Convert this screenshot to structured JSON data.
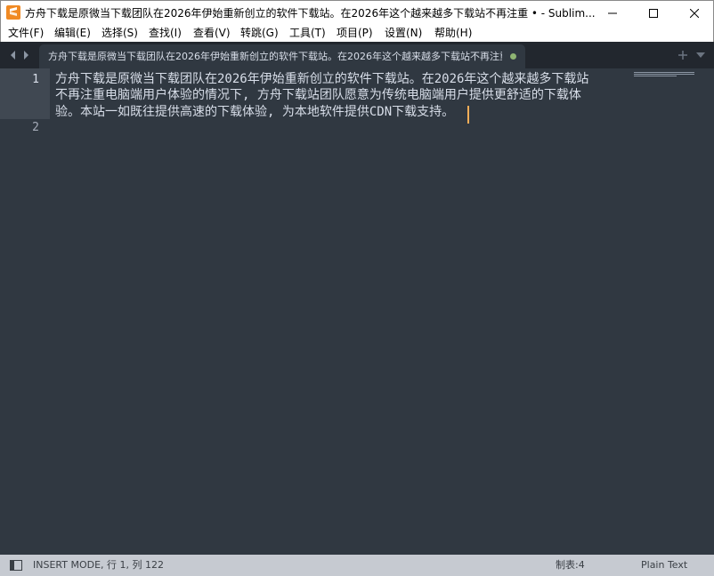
{
  "window": {
    "title": "方舟下载是原微当下载团队在2026年伊始重新创立的软件下载站。在2026年这个越来越多下载站不再注重 • - Sublim...",
    "app_icon": "sublime-text-icon",
    "buttons": {
      "minimize_icon": "minimize-icon",
      "maximize_icon": "maximize-icon",
      "close_icon": "close-icon"
    }
  },
  "menu": {
    "items": [
      "文件(F)",
      "编辑(E)",
      "选择(S)",
      "查找(I)",
      "查看(V)",
      "转跳(G)",
      "工具(T)",
      "项目(P)",
      "设置(N)",
      "帮助(H)"
    ]
  },
  "tabs": {
    "nav_left_icon": "chevron-left-icon",
    "nav_right_icon": "chevron-right-icon",
    "active_tab_title": "方舟下载是原微当下载团队在2026年伊始重新创立的软件下载站。在2026年这个越来越多下载站不再注重",
    "dirty_indicator": "modified-dot-icon",
    "add_icon": "plus-icon",
    "menu_icon": "chevron-down-icon"
  },
  "editor": {
    "line_numbers": [
      "1",
      "2"
    ],
    "wrapped_lines": [
      "方舟下载是原微当下载团队在2026年伊始重新创立的软件下载站。在2026年这个越来越多下载站",
      "不再注重电脑端用户体验的情况下, 方舟下载站团队愿意为传统电脑端用户提供更舒适的下载体",
      "验。本站一如既往提供高速的下载体验, 为本地软件提供CDN下载支持。"
    ]
  },
  "status": {
    "mode": "INSERT MODE, 行 1, 列",
    "char_count": "122",
    "tab_size": "制表:4",
    "syntax": "Plain Text"
  },
  "colors": {
    "editor_bg": "#303841",
    "tabbar_bg": "#22272e",
    "caret": "#f9ae58",
    "dirty_dot": "#8fb573",
    "statusbar_bg": "#c6cad1"
  }
}
